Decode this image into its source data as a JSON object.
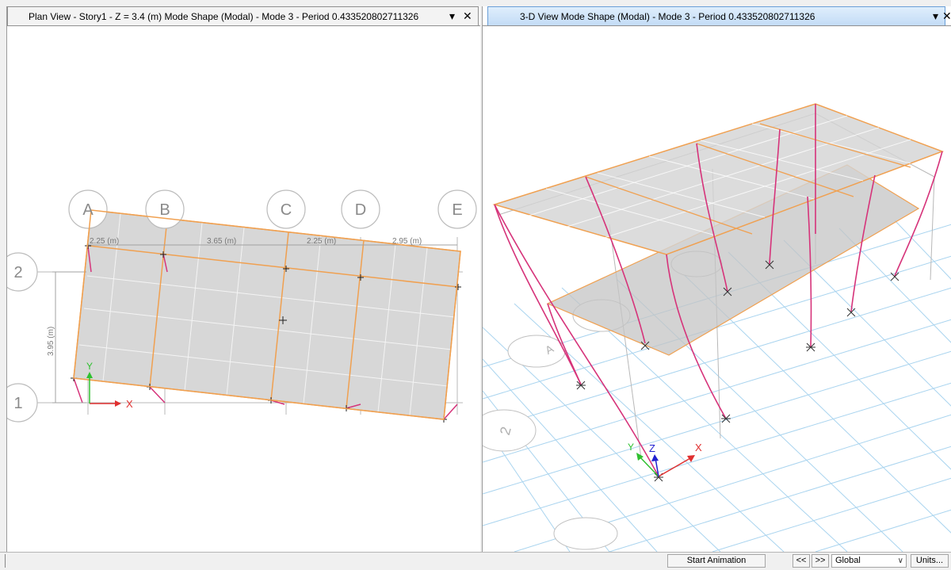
{
  "left_view": {
    "title": "Plan View - Story1 - Z = 3.4 (m)  Mode Shape (Modal) - Mode 3 - Period 0.433520802711326",
    "grid_x": [
      "A",
      "B",
      "C",
      "D",
      "E"
    ],
    "grid_y": [
      "2",
      "1"
    ],
    "dimensions": [
      "2.25 (m)",
      "3.65 (m)",
      "2.25 (m)",
      "2.95 (m)"
    ],
    "dim_y": "3.95 (m)",
    "axis_x": "X",
    "axis_y": "Y"
  },
  "right_view": {
    "title": "3-D View  Mode Shape (Modal) - Mode 3 - Period 0.433520802711326",
    "grid_labels": [
      "A",
      "2"
    ],
    "axis_x": "X",
    "axis_y": "Y",
    "axis_z": "Z"
  },
  "tab_controls": {
    "dropdown": "▾",
    "close": "✕"
  },
  "status_bar": {
    "start_animation": "Start Animation",
    "prev": "<<",
    "next": ">>",
    "coord_system": "Global",
    "units": "Units..."
  },
  "colors": {
    "slab": "#d7d7d7",
    "beam": "#f0a050",
    "column": "#d6337a",
    "grid": "#9ac8e8",
    "axis_x": "#e03030",
    "axis_y": "#30c030",
    "axis_z": "#2020d0"
  }
}
